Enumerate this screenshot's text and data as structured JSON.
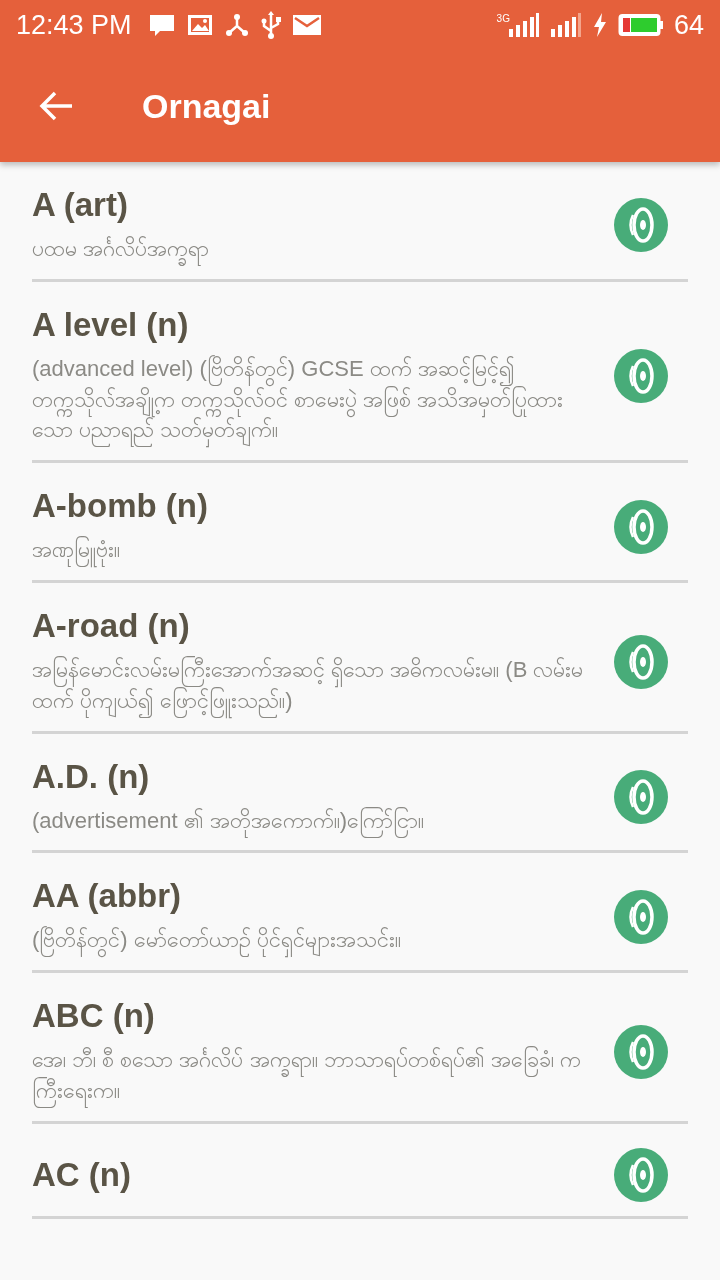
{
  "status_bar": {
    "time": "12:43 PM",
    "network": "3G",
    "battery": "64"
  },
  "app_bar": {
    "title": "Ornagai"
  },
  "entries": [
    {
      "word": "A (art)",
      "definition": "ပထမ အင်္ဂလိပ်အက္ခရာ"
    },
    {
      "word": "A level (n)",
      "definition": "(advanced level) (ဗြိတိန်တွင်) GCSE ထက် အဆင့်မြင့်၍ တက္ကသိုလ်အချို့က တက္ကသိုလ်ဝင် စာမေးပွဲ အဖြစ် အသိအမှတ်ပြုထားသော ပညာရည် သတ်မှတ်ချက်။"
    },
    {
      "word": "A-bomb (n)",
      "definition": "အဏုမြူဗုံး။"
    },
    {
      "word": "A-road (n)",
      "definition": "အမြန်မောင်းလမ်းမကြီးအောက်အဆင့် ရှိသော အဓိကလမ်းမ။ (B လမ်းမထက် ပိုကျယ်၍ ဖြောင့်ဖြူးသည်။)"
    },
    {
      "word": "A.D. (n)",
      "definition": "(advertisement ၏ အတိုအကောက်။)ကြော်ငြာ။"
    },
    {
      "word": "AA (abbr)",
      "definition": "(ဗြိတိန်တွင်) မော်တော်ယာဉ် ပိုင်ရှင်များအသင်း။"
    },
    {
      "word": "ABC (n)",
      "definition": "အေ၊ ဘီ၊ စီ စသော အင်္ဂလိပ် အက္ခရာ။ ဘာသာရပ်တစ်ရပ်၏ အခြေခံ၊ ကကြီးရေးက။"
    },
    {
      "word": "AC (n)"
    }
  ]
}
